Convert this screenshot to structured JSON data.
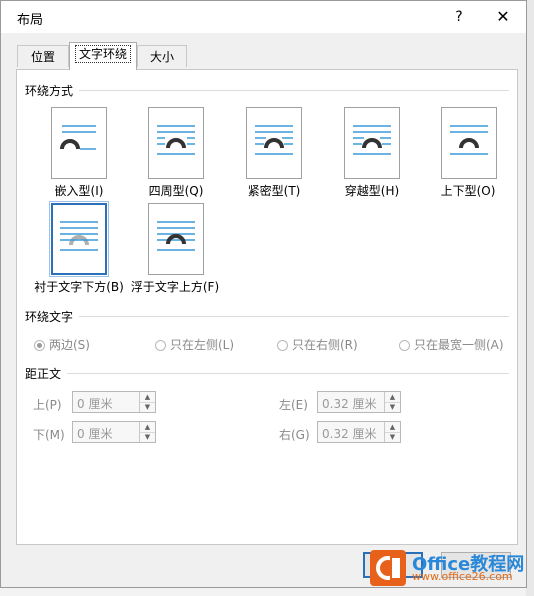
{
  "window": {
    "title": "布局",
    "help_label": "?",
    "close_label": "✕"
  },
  "tabs": [
    {
      "label": "位置",
      "active": false
    },
    {
      "label": "文字环绕",
      "active": true
    },
    {
      "label": "大小",
      "active": false
    }
  ],
  "wrap_style": {
    "heading": "环绕方式",
    "options": [
      {
        "label": "嵌入型(I)",
        "icon": "inline-wrap-icon"
      },
      {
        "label": "四周型(Q)",
        "icon": "square-wrap-icon"
      },
      {
        "label": "紧密型(T)",
        "icon": "tight-wrap-icon"
      },
      {
        "label": "穿越型(H)",
        "icon": "through-wrap-icon"
      },
      {
        "label": "上下型(O)",
        "icon": "top-bottom-wrap-icon"
      },
      {
        "label": "衬于文字下方(B)",
        "icon": "behind-text-icon",
        "selected": true
      },
      {
        "label": "浮于文字上方(F)",
        "icon": "in-front-text-icon"
      }
    ]
  },
  "wrap_text": {
    "heading": "环绕文字",
    "options": [
      {
        "label": "两边(S)",
        "checked": true
      },
      {
        "label": "只在左侧(L)",
        "checked": false
      },
      {
        "label": "只在右侧(R)",
        "checked": false
      },
      {
        "label": "只在最宽一侧(A)",
        "checked": false
      }
    ]
  },
  "distance": {
    "heading": "距正文",
    "top_label": "上(P)",
    "top_value": "0 厘米",
    "bottom_label": "下(M)",
    "bottom_value": "0 厘米",
    "left_label": "左(E)",
    "left_value": "0.32 厘米",
    "right_label": "右(G)",
    "right_value": "0.32 厘米"
  },
  "watermark": {
    "line1": "Office教程网",
    "line2": "www.office26.com"
  },
  "colors": {
    "accent": "#2a6fb8",
    "line_blue": "#3a9ad9",
    "arch": "#333333"
  }
}
